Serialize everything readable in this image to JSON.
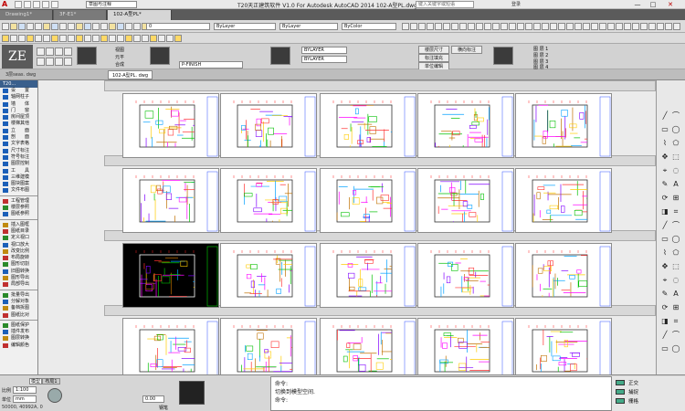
{
  "window": {
    "title": "T20天正建筑软件 V1.0 For Autodesk AutoCAD 2014    102-A型PL.dwg",
    "workspace": "草图与注释",
    "search_placeholder": "键入关键字或短语",
    "login": "登录",
    "controls": [
      "—",
      "□",
      "✕"
    ]
  },
  "doc_tabs": [
    {
      "label": "Drawing1*",
      "active": false
    },
    {
      "label": "3F-E1*",
      "active": false
    },
    {
      "label": "102-A型PL*",
      "active": true
    }
  ],
  "toolbar": {
    "layer_combo": "0",
    "color_combo": "ByLayer",
    "linetype_combo": "ByLayer",
    "lineweight_combo": "ByLayer",
    "plot_combo": "ByColor",
    "layer_name": "P-FINISH",
    "linetype_names": [
      "BYLAYER",
      "BYLAYER"
    ],
    "text_buttons": [
      "楼层尺寸",
      "标注填充",
      "单位编辑",
      "横向标注"
    ],
    "radio_labels": [
      "视图",
      "元平",
      "合成"
    ],
    "layer_toggle_labels": [
      "图 层 1",
      "图 层 2",
      "图 层 3",
      "图 层 4"
    ]
  },
  "model_tabs": [
    "模型",
    "布局1"
  ],
  "file_tab_strip": [
    "3层seas. dwg",
    "102-A型PL. dwg"
  ],
  "left_palette": {
    "header": "T20...",
    "items": [
      "设　　置",
      "轴网柱子",
      "墙　　体",
      "门　　窗",
      "房间屋顶",
      "楼梯其他",
      "立　　面",
      "剖　　面",
      "文字表格",
      "尺寸标注",
      "符号标注",
      "图层控制",
      "工　　具",
      "三维建模",
      "图块图案",
      "文件布图",
      "工程管理",
      "楼层参照",
      "图纸参照",
      "插入图框",
      "图纸目录",
      "定义视口",
      "视口放大",
      "改变比例",
      "布局旋转",
      "图形切割",
      "旧图转换",
      "图形导出",
      "局部导出",
      "批量导出",
      "分解对象",
      "备档拆图",
      "图纸比对",
      "图纸保护",
      "插件发布",
      "图层转换",
      "编辑颜色"
    ]
  },
  "drawings": {
    "rows": 4,
    "cols": 5,
    "selected_index": 10
  },
  "command_window": {
    "lines": [
      "命令:",
      "切换到模型空间.",
      "命令:"
    ]
  },
  "status": {
    "scale_label": "比例",
    "scale_value": "1:100",
    "unit_label": "单位",
    "unit_value": "mm",
    "coords": "50000,  40992A, 0",
    "height_label": "0.00",
    "right_items": [
      "正交",
      "捕捉",
      "栅格"
    ],
    "layout_tab_labels": [
      "模型",
      "布局1"
    ],
    "ui_tag": "钢笔"
  }
}
